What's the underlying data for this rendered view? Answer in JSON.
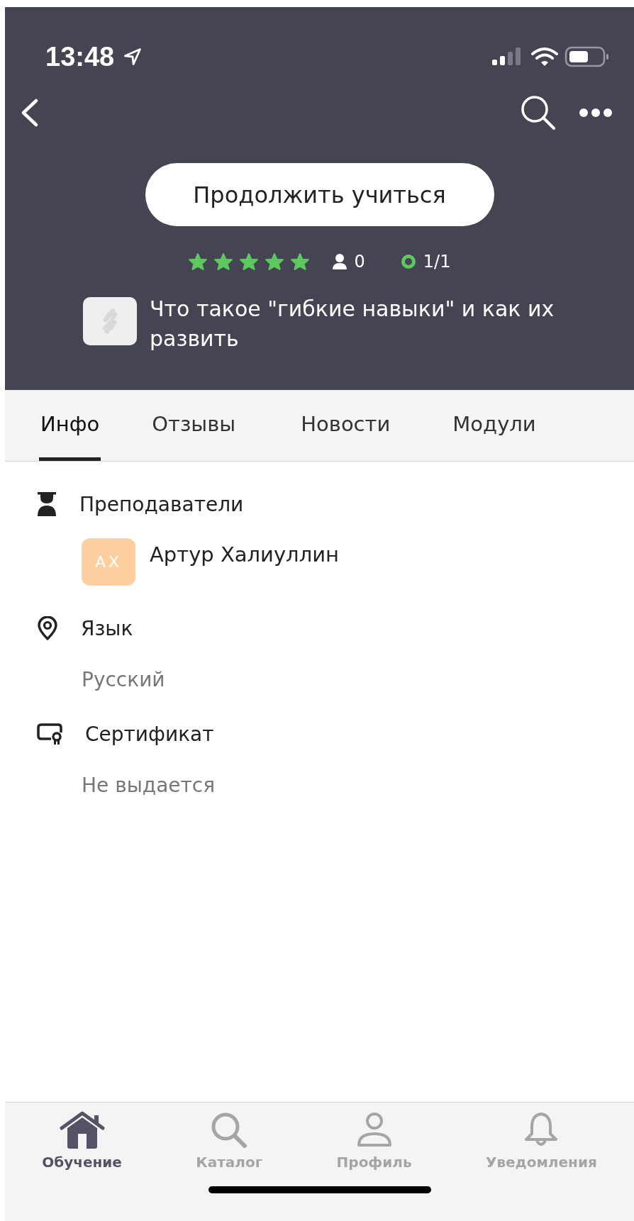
{
  "status_bar": {
    "time": "13:48"
  },
  "header": {
    "continue_button": "Продолжить учиться",
    "rating": {
      "stars": 5
    },
    "students": "0",
    "progress": "1/1",
    "course_title": "Что такое  \"гибкие навыки\" и как их развить"
  },
  "tabs": [
    {
      "label": "Инфо",
      "selected": true
    },
    {
      "label": "Отзывы",
      "selected": false
    },
    {
      "label": "Новости",
      "selected": false
    },
    {
      "label": "Модули",
      "selected": false
    }
  ],
  "sections": [
    {
      "kind": "teachers",
      "title": "Преподаватели",
      "teachers": [
        {
          "initials": "AX",
          "name": "Артур Халиуллин"
        }
      ]
    },
    {
      "kind": "language",
      "title": "Язык",
      "value": "Русский"
    },
    {
      "kind": "certificate",
      "title": "Сертификат",
      "value": "Не выдается"
    }
  ],
  "bottom_nav": [
    {
      "kind": "home",
      "label": "Обучение",
      "selected": true
    },
    {
      "kind": "search",
      "label": "Каталог",
      "selected": false
    },
    {
      "kind": "profile",
      "label": "Профиль",
      "selected": false
    },
    {
      "kind": "bell",
      "label": "Уведомления",
      "selected": false
    }
  ]
}
